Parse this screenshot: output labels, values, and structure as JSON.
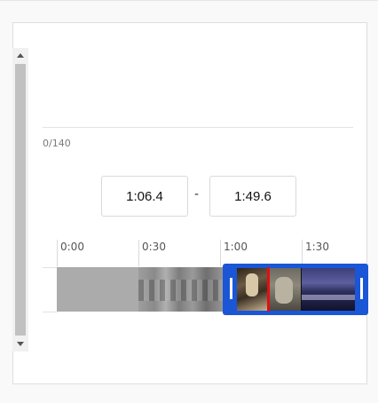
{
  "counter": "0/140",
  "range": {
    "start": "1:06.4",
    "separator": "-",
    "end": "1:49.6"
  },
  "ruler": {
    "ticks": [
      "0:00",
      "0:30",
      "1:00",
      "1:30"
    ]
  },
  "colors": {
    "selection": "#1a56d6",
    "playhead": "#e01010"
  }
}
